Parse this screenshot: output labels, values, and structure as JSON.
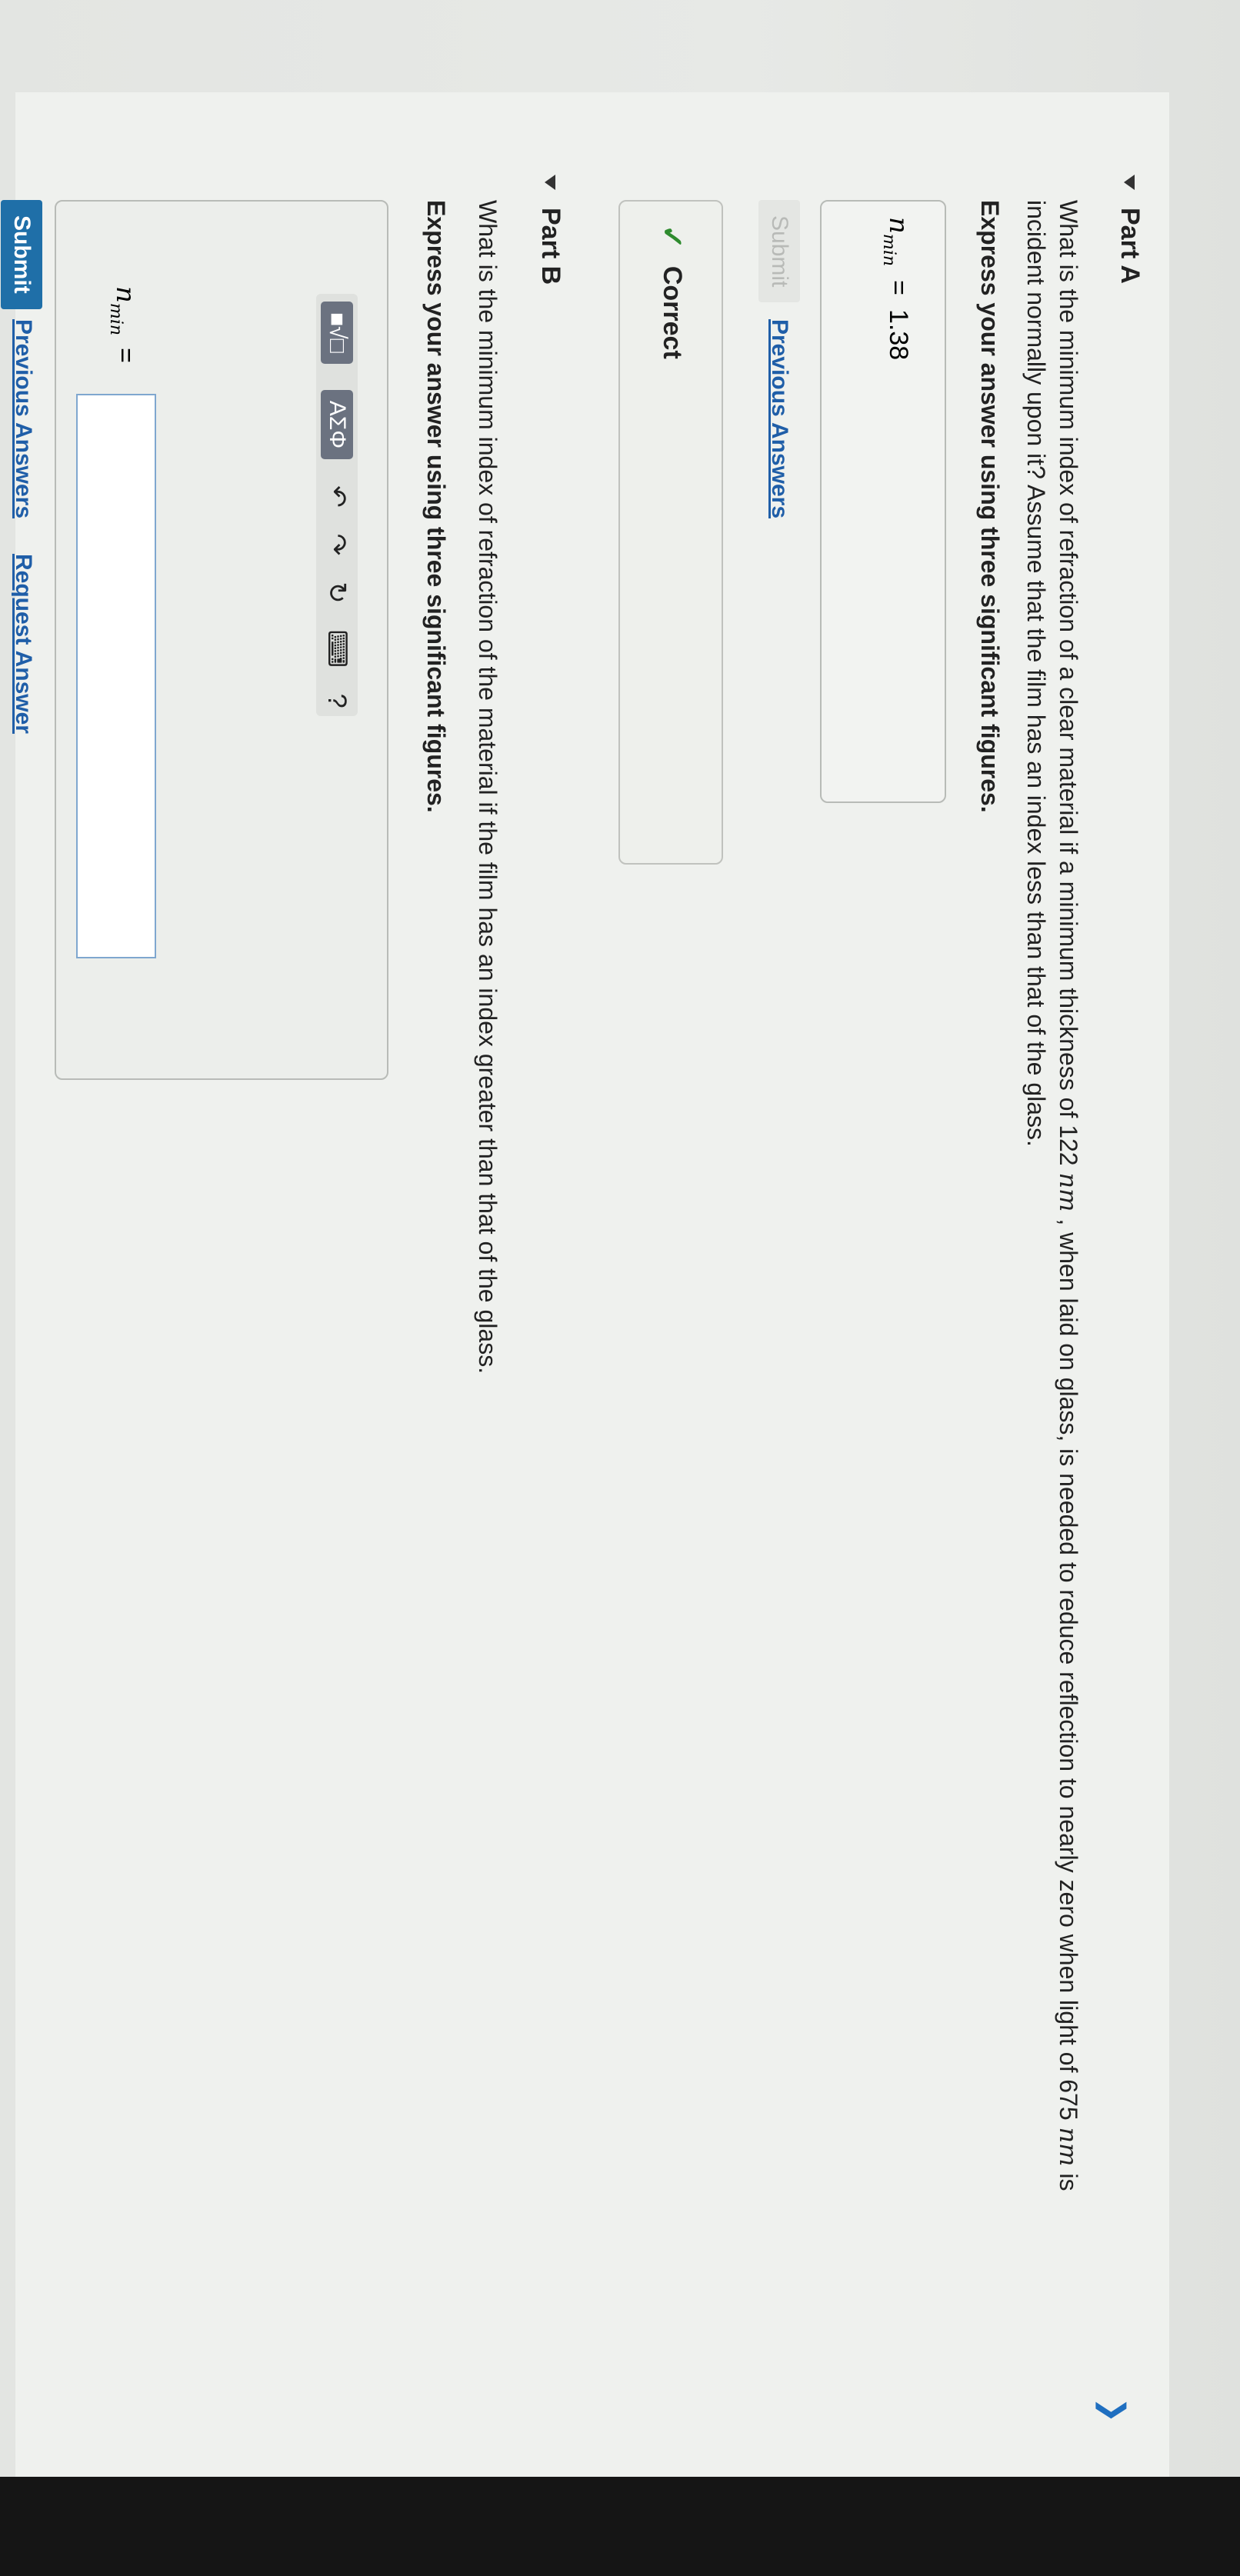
{
  "partA": {
    "title": "Part A",
    "question_pre": "What is the minimum index of refraction of a clear material if a minimum thickness of 122 ",
    "unit1": "nm",
    "question_mid": " , when laid on glass, is needed to reduce reflection to nearly zero when light of 675 ",
    "unit2": "nm",
    "question_post": " is",
    "question_line2": "incident normally upon it? Assume that the film has an index less than that of the glass.",
    "instruction": "Express your answer using three significant figures.",
    "var_main": "n",
    "var_sub": "min",
    "equals": "=",
    "answer": "1.38",
    "submit": "Submit",
    "previous": "Previous Answers",
    "correct": "Correct",
    "check": "✓"
  },
  "partB": {
    "title": "Part B",
    "question": "What is the minimum index of refraction of the material if the film has an index greater than that of the glass.",
    "instruction": "Express your answer using three significant figures.",
    "toolbar": {
      "templates": "■√□",
      "greek": "ΑΣΦ",
      "undo": "↶",
      "redo": "↷",
      "reset": "↻",
      "keyboard": "⌨",
      "help": "?"
    },
    "var_main": "n",
    "var_sub": "min",
    "equals": "=",
    "answer_value": "",
    "submit": "Submit",
    "previous": "Previous Answers",
    "request": "Request Answer"
  },
  "collapse_chevron": "❯",
  "colors": {
    "accent": "#1f5ea8",
    "correct": "#2e8b2e",
    "submit_bg": "#1f6fa8"
  }
}
